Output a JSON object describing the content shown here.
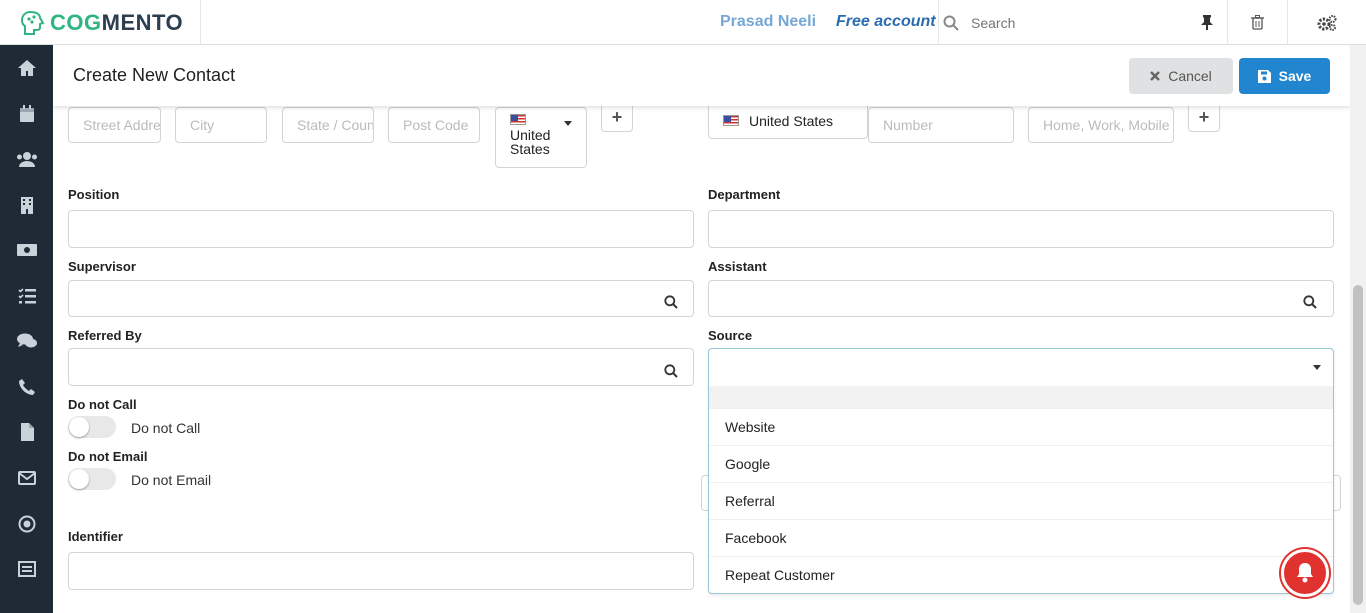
{
  "app": {
    "logo_text_a": "COG",
    "logo_text_b": "MENTO",
    "user_name": "Prasad Neeli",
    "account_type": "Free account",
    "search_placeholder": "Search"
  },
  "sidebar": {
    "icons": [
      "home-icon",
      "calendar-icon",
      "contacts-icon",
      "companies-icon",
      "deals-icon",
      "tasks-icon",
      "cases-icon",
      "calls-icon",
      "documents-icon",
      "email-icon",
      "campaigns-icon",
      "forms-icon"
    ]
  },
  "header": {
    "title": "Create New Contact",
    "cancel_label": "Cancel",
    "save_label": "Save"
  },
  "address": {
    "street_placeholder": "Street Address",
    "city_placeholder": "City",
    "state_placeholder": "State / County",
    "postcode_placeholder": "Post Code",
    "country_value": "United States"
  },
  "phone": {
    "country_value": "United States",
    "number_placeholder": "Number",
    "type_placeholder": "Home, Work, Mobile"
  },
  "form": {
    "position_label": "Position",
    "department_label": "Department",
    "supervisor_label": "Supervisor",
    "assistant_label": "Assistant",
    "referred_by_label": "Referred By",
    "source_label": "Source",
    "do_not_call_label": "Do not Call",
    "do_not_call_toggle": "Do not Call",
    "do_not_email_label": "Do not Email",
    "do_not_email_toggle": "Do not Email",
    "identifier_label": "Identifier"
  },
  "source_dropdown": {
    "options": [
      "Website",
      "Google",
      "Referral",
      "Facebook",
      "Repeat Customer"
    ]
  },
  "colors": {
    "sidebar": "#1f2a36",
    "save": "#2185d0",
    "brand_green": "#2fb67e",
    "notification": "#e0322f"
  }
}
